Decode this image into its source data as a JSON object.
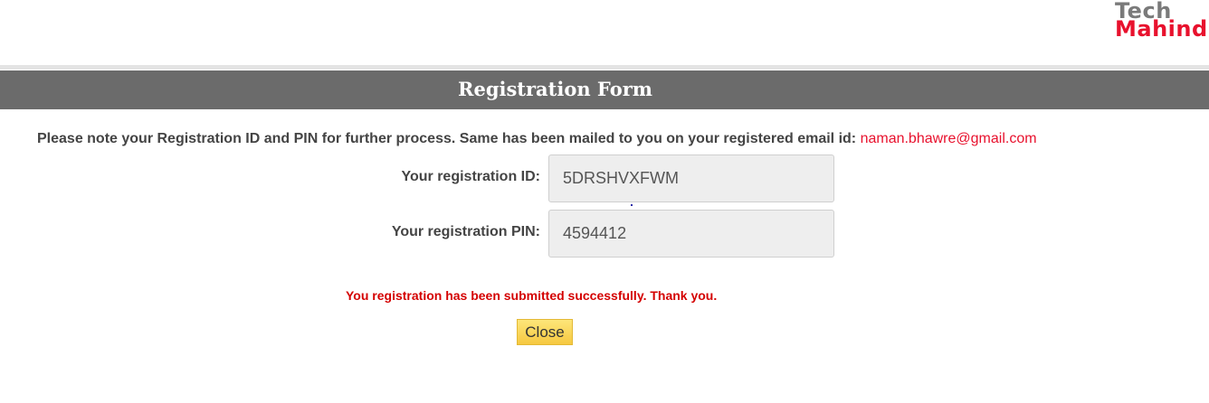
{
  "logo": {
    "line1": "Tech",
    "line2": "Mahindra"
  },
  "header": {
    "title": "Registration Form"
  },
  "notice": {
    "text": "Please note your Registration ID and PIN for further process. Same has been mailed to you on your registered email id:",
    "email": "naman.bhawre@gmail.com"
  },
  "fields": {
    "id_label": "Your registration ID:",
    "id_value": "5DRSHVXFWM",
    "pin_label": "Your registration PIN:",
    "pin_value": "4594412"
  },
  "status": {
    "message": "You registration has been submitted successfully. Thank you."
  },
  "actions": {
    "close_label": "Close"
  },
  "colors": {
    "brand_red": "#e8112d",
    "header_bg": "#6b6b6b",
    "button_bg": "#f9d45c"
  }
}
